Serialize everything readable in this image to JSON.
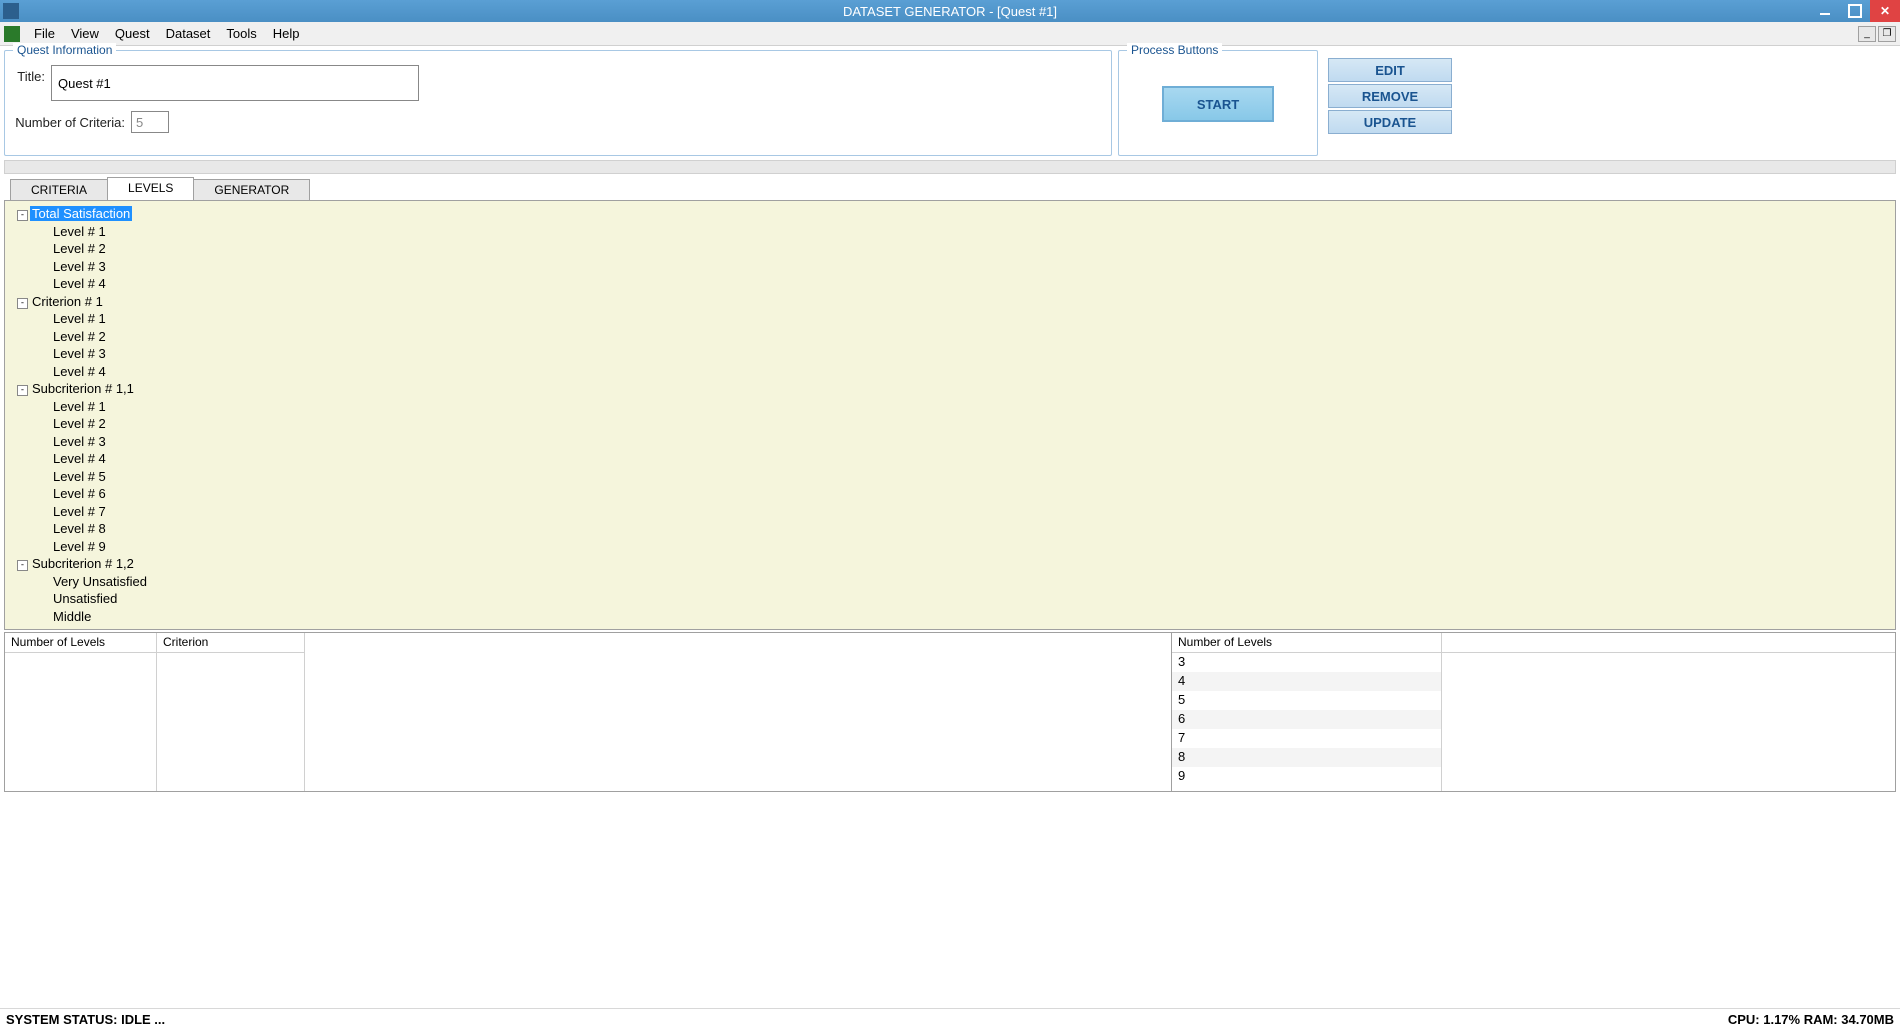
{
  "window": {
    "title": "DATASET GENERATOR - [Quest #1]"
  },
  "menu": {
    "items": [
      "File",
      "View",
      "Quest",
      "Dataset",
      "Tools",
      "Help"
    ]
  },
  "quest_info": {
    "group_title": "Quest Information",
    "title_label": "Title:",
    "title_value": "Quest #1",
    "num_criteria_label": "Number of Criteria:",
    "num_criteria_value": "5"
  },
  "process": {
    "group_title": "Process Buttons",
    "start_label": "START"
  },
  "actions": {
    "edit": "EDIT",
    "remove": "REMOVE",
    "update": "UPDATE"
  },
  "tabs": {
    "criteria": "CRITERIA",
    "levels": "LEVELS",
    "generator": "GENERATOR"
  },
  "tree": [
    {
      "label": "Total Satisfaction",
      "depth": 0,
      "toggle": "-",
      "selected": true
    },
    {
      "label": "Level # 1",
      "depth": 1
    },
    {
      "label": "Level # 2",
      "depth": 1
    },
    {
      "label": "Level # 3",
      "depth": 1
    },
    {
      "label": "Level # 4",
      "depth": 1
    },
    {
      "label": "Criterion # 1",
      "depth": 0,
      "toggle": "-"
    },
    {
      "label": "Level # 1",
      "depth": 1
    },
    {
      "label": "Level # 2",
      "depth": 1
    },
    {
      "label": "Level # 3",
      "depth": 1
    },
    {
      "label": "Level # 4",
      "depth": 1
    },
    {
      "label": "Subcriterion # 1,1",
      "depth": 0,
      "toggle": "-"
    },
    {
      "label": "Level # 1",
      "depth": 1
    },
    {
      "label": "Level # 2",
      "depth": 1
    },
    {
      "label": "Level # 3",
      "depth": 1
    },
    {
      "label": "Level # 4",
      "depth": 1
    },
    {
      "label": "Level # 5",
      "depth": 1
    },
    {
      "label": "Level # 6",
      "depth": 1
    },
    {
      "label": "Level # 7",
      "depth": 1
    },
    {
      "label": "Level # 8",
      "depth": 1
    },
    {
      "label": "Level # 9",
      "depth": 1
    },
    {
      "label": "Subcriterion # 1,2",
      "depth": 0,
      "toggle": "-"
    },
    {
      "label": "Very Unsatisfied",
      "depth": 1
    },
    {
      "label": "Unsatisfied",
      "depth": 1
    },
    {
      "label": "Middle",
      "depth": 1
    }
  ],
  "grid": {
    "left_headers": {
      "col1": "Number of Levels",
      "col2": "Criterion"
    },
    "right_header": "Number of Levels",
    "right_values": [
      "3",
      "4",
      "5",
      "6",
      "7",
      "8",
      "9"
    ]
  },
  "status": {
    "left": "SYSTEM STATUS: IDLE ...",
    "right": "CPU: 1.17% RAM: 34.70MB"
  }
}
